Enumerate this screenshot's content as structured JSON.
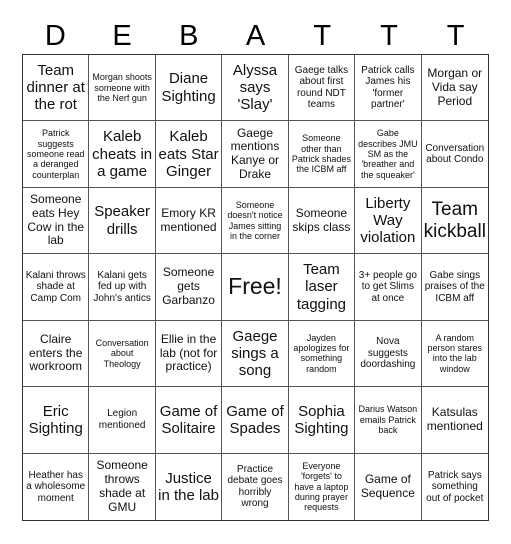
{
  "header": [
    "D",
    "E",
    "B",
    "A",
    "T",
    "T",
    "T"
  ],
  "cells": [
    "Team dinner at the rot",
    "Morgan shoots someone with the Nerf gun",
    "Diane Sighting",
    "Alyssa says 'Slay'",
    "Gaege talks about first round NDT teams",
    "Patrick calls James his 'former partner'",
    "Morgan or Vida say Period",
    "Patrick suggests someone read a deranged counterplan",
    "Kaleb cheats in a game",
    "Kaleb eats Star Ginger",
    "Gaege mentions Kanye or Drake",
    "Someone other than Patrick shades the ICBM aff",
    "Gabe describes JMU SM as the 'breather and the squeaker'",
    "Conversation about Condo",
    "Someone eats Hey Cow in the lab",
    "Speaker drills",
    "Emory KR mentioned",
    "Someone doesn't notice James sitting in the corner",
    "Someone skips class",
    "Liberty Way violation",
    "Team kickball",
    "Kalani throws shade at Camp Com",
    "Kalani gets fed up with John's antics",
    "Someone gets Garbanzo",
    "Free!",
    "Team laser tagging",
    "3+ people go to get Slims at once",
    "Gabe sings praises of the ICBM aff",
    "Claire enters the workroom",
    "Conversation about Theology",
    "Ellie in the lab (not for practice)",
    "Gaege sings a song",
    "Jayden apologizes for something random",
    "Nova suggests doordashing",
    "A random person stares into the lab window",
    "Eric Sighting",
    "Legion mentioned",
    "Game of Solitaire",
    "Game of Spades",
    "Sophia Sighting",
    "Darius Watson emails Patrick back",
    "Katsulas mentioned",
    "Heather has a wholesome moment",
    "Someone throws shade at GMU",
    "Justice in the lab",
    "Practice debate goes horribly wrong",
    "Everyone 'forgets' to have a laptop during prayer requests",
    "Game of Sequence",
    "Patrick says something out of pocket"
  ]
}
